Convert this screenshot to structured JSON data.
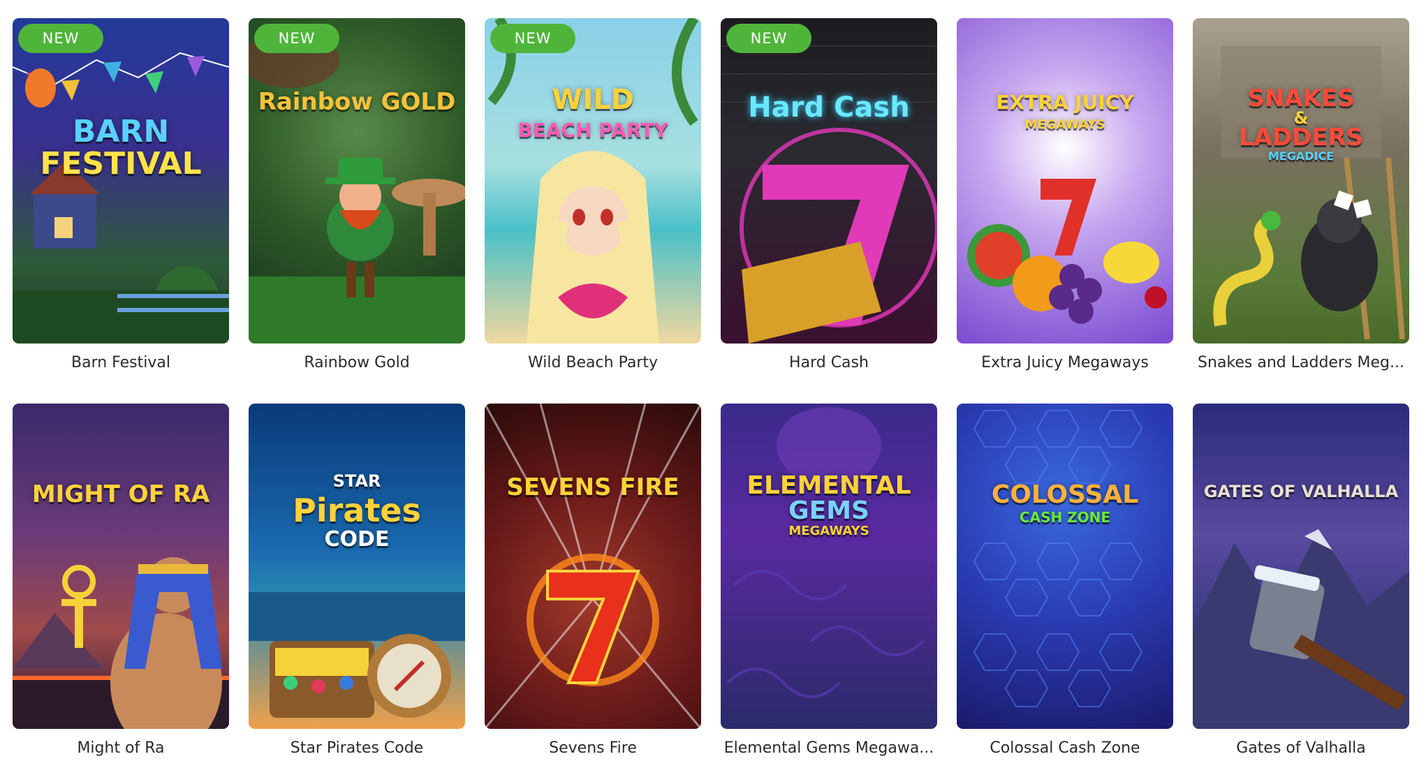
{
  "badge_label": "NEW",
  "games": [
    {
      "name": "Barn Festival",
      "logo_lines": [
        "BARN",
        "FESTIVAL"
      ],
      "is_new": true
    },
    {
      "name": "Rainbow Gold",
      "logo_lines": [
        "Rainbow GOLD"
      ],
      "is_new": true
    },
    {
      "name": "Wild Beach Party",
      "logo_lines": [
        "WILD",
        "BEACH PARTY"
      ],
      "is_new": true
    },
    {
      "name": "Hard Cash",
      "logo_lines": [
        "Hard Cash"
      ],
      "is_new": true
    },
    {
      "name": "Extra Juicy Megaways",
      "logo_lines": [
        "EXTRA JUICY",
        "MEGAWAYS"
      ],
      "is_new": false
    },
    {
      "name": "Snakes and Ladders Meg...",
      "logo_lines": [
        "SNAKES",
        "&",
        "LADDERS",
        "MEGADICE"
      ],
      "is_new": false
    },
    {
      "name": "Might of Ra",
      "logo_lines": [
        "MIGHT OF RA"
      ],
      "is_new": false
    },
    {
      "name": "Star Pirates Code",
      "logo_lines": [
        "STAR",
        "Pirates",
        "CODE"
      ],
      "is_new": false
    },
    {
      "name": "Sevens Fire",
      "logo_lines": [
        "SEVENS FIRE"
      ],
      "is_new": false
    },
    {
      "name": "Elemental Gems Megawa...",
      "logo_lines": [
        "ELEMENTAL",
        "GEMS",
        "MEGAWAYS"
      ],
      "is_new": false
    },
    {
      "name": "Colossal Cash Zone",
      "logo_lines": [
        "COLOSSAL",
        "CASH ZONE"
      ],
      "is_new": false
    },
    {
      "name": "Gates of Valhalla",
      "logo_lines": [
        "GATES OF VALHALLA"
      ],
      "is_new": false
    }
  ],
  "colors": {
    "badge": "#4fb53a",
    "caption": "#2a2a2a"
  }
}
